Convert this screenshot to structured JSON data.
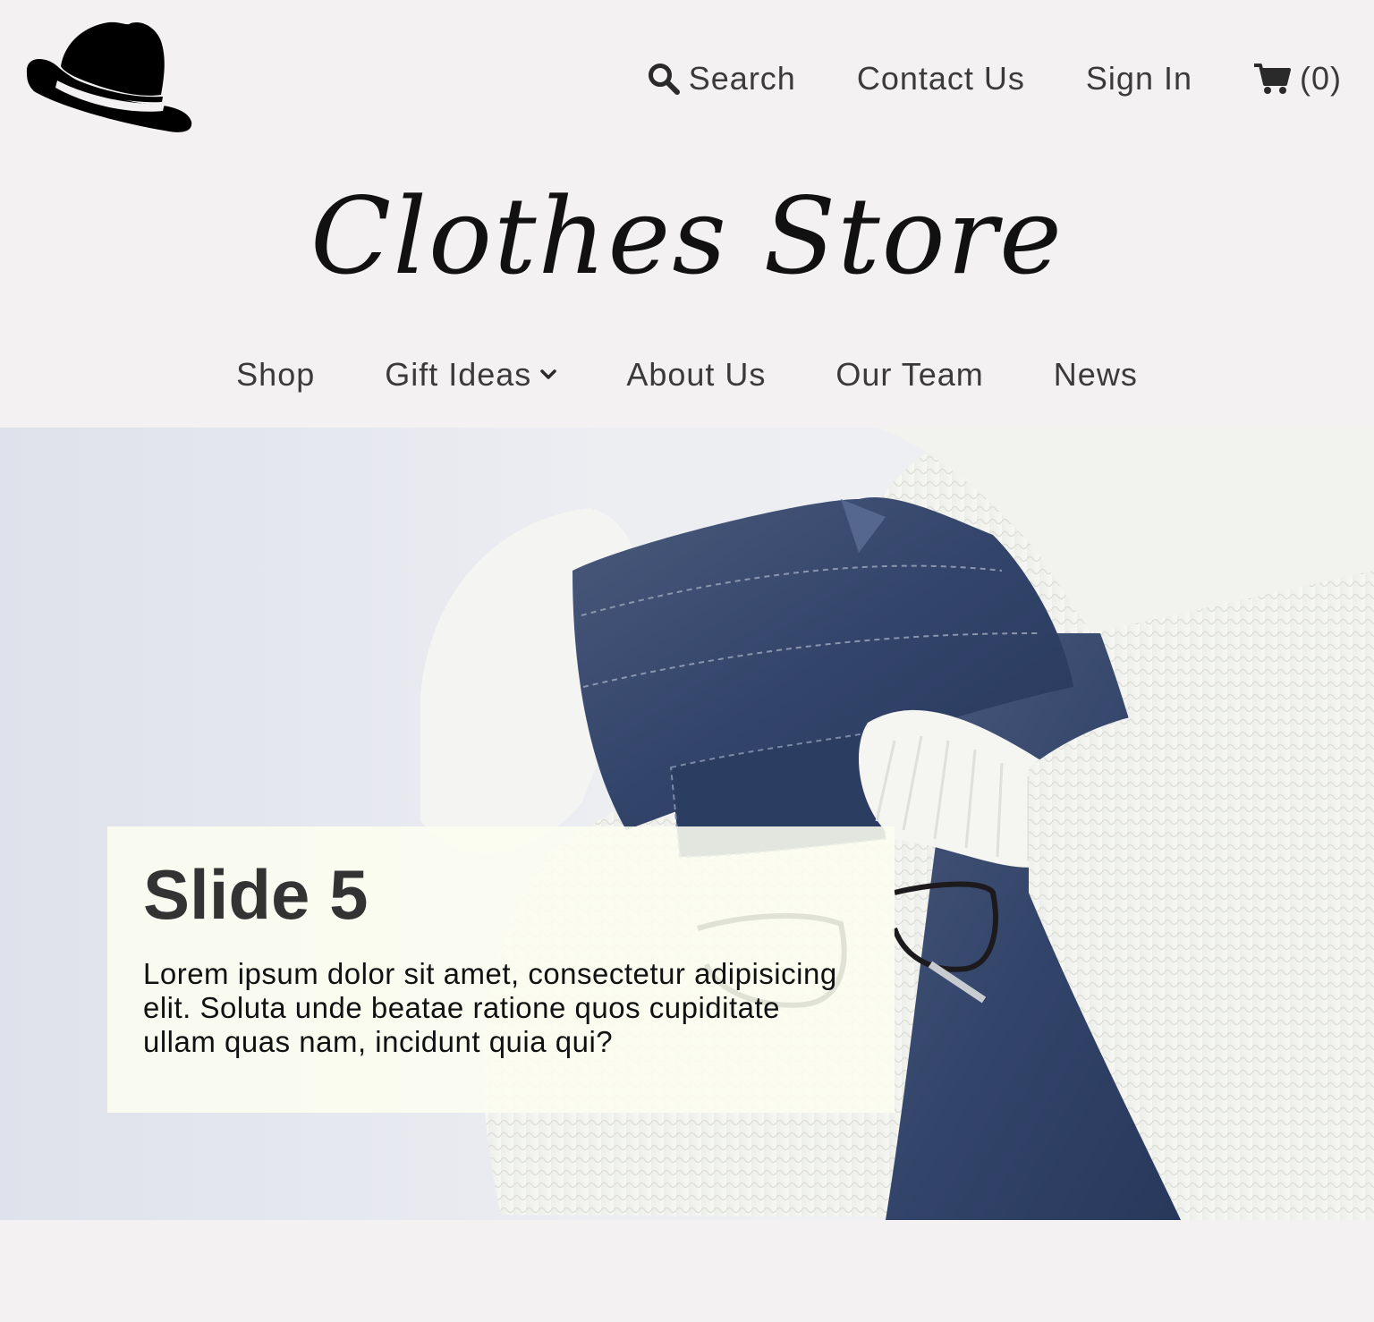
{
  "header": {
    "logo_icon": "hat-icon",
    "search_label": "Search",
    "contact_label": "Contact Us",
    "signin_label": "Sign In",
    "cart_count": "(0)"
  },
  "title": "Clothes Store",
  "nav": {
    "items": [
      {
        "label": "Shop"
      },
      {
        "label": "Gift Ideas"
      },
      {
        "label": "About Us"
      },
      {
        "label": "Our Team"
      },
      {
        "label": "News"
      }
    ]
  },
  "slide": {
    "title": "Slide 5",
    "text": "Lorem ipsum dolor sit amet, consectetur adipisicing elit. Soluta unde beatae ratione quos cupiditate ullam quas nam, incidunt quia qui?"
  },
  "colors": {
    "background": "#f3f1f2",
    "caption_bg": "#fdfef0",
    "denim": "#34466a",
    "sweater": "#f4f3ee"
  }
}
